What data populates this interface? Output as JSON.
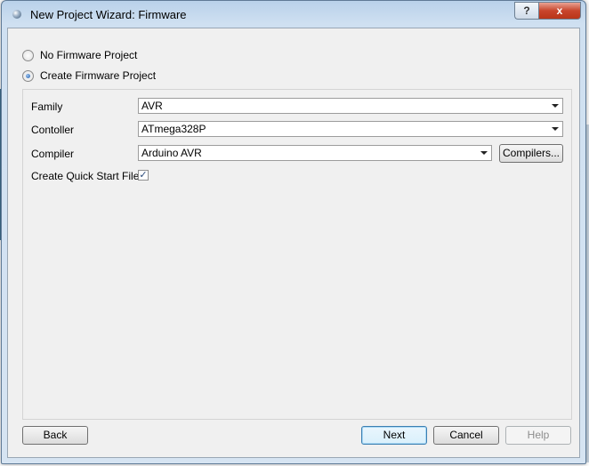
{
  "window": {
    "title": "New Project Wizard: Firmware",
    "help_button": "?",
    "close_button": "x"
  },
  "options": {
    "no_firmware": {
      "label": "No Firmware Project",
      "selected": false
    },
    "create_firmware": {
      "label": "Create Firmware Project",
      "selected": true
    }
  },
  "form": {
    "family": {
      "label": "Family",
      "value": "AVR"
    },
    "controller": {
      "label": "Contoller",
      "value": "ATmega328P"
    },
    "compiler": {
      "label": "Compiler",
      "value": "Arduino AVR",
      "button": "Compilers..."
    },
    "quick_start": {
      "label": "Create Quick Start Files",
      "checked": true
    }
  },
  "footer": {
    "back": "Back",
    "next": "Next",
    "cancel": "Cancel",
    "help": "Help"
  },
  "icons": {
    "checkmark": "✓"
  }
}
